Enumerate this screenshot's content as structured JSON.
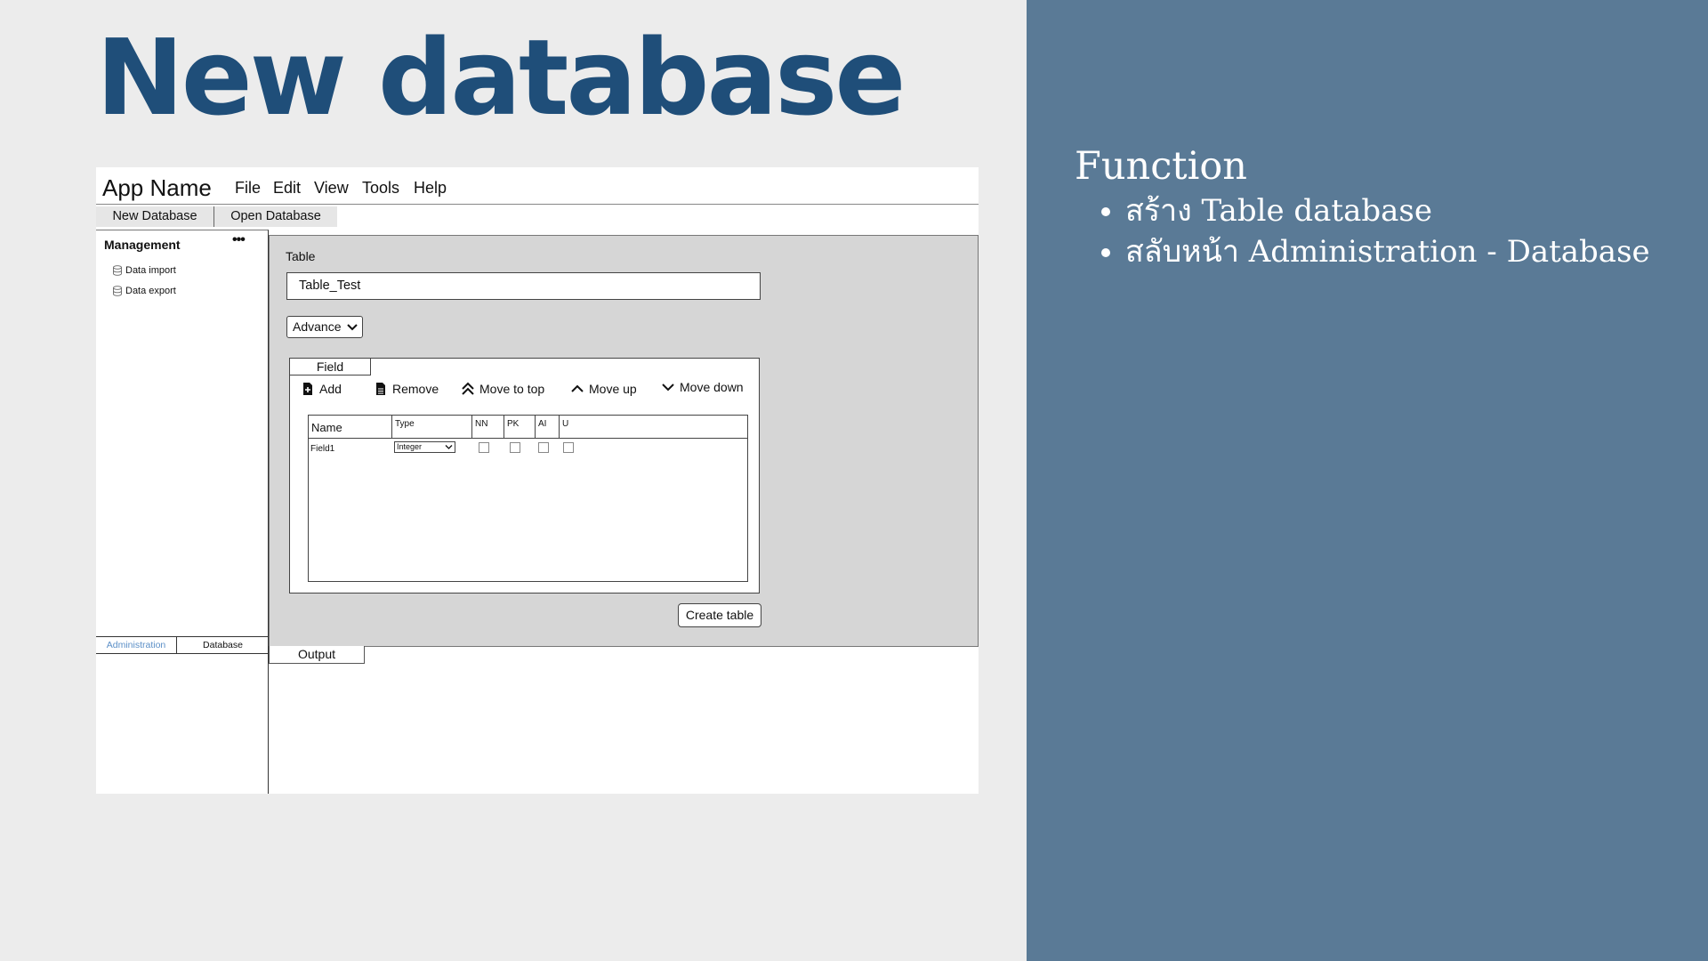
{
  "slide": {
    "title": "New database"
  },
  "function_panel": {
    "heading": "Function",
    "items": [
      "สร้าง Table database",
      "สลับหน้า Administration - Database"
    ]
  },
  "app": {
    "name": "App Name",
    "menu": [
      "File",
      "Edit",
      "View",
      "Tools",
      "Help"
    ],
    "toolbar_tabs": [
      "New Database",
      "Open Database"
    ]
  },
  "sidebar": {
    "title": "Management",
    "more": "•••",
    "items": [
      {
        "label": "Data import",
        "icon": "database-icon"
      },
      {
        "label": "Data export",
        "icon": "database-icon"
      }
    ],
    "tabs": [
      {
        "label": "Administration",
        "active": true
      },
      {
        "label": "Database",
        "active": false
      }
    ]
  },
  "editor": {
    "table_label": "Table",
    "table_name": "Table_Test",
    "advance_label": "Advance",
    "field_tab": "Field",
    "tools": [
      {
        "label": "Add",
        "icon": "add-file-icon"
      },
      {
        "label": "Remove",
        "icon": "remove-file-icon"
      },
      {
        "label": "Move to top",
        "icon": "double-chevron-up-icon"
      },
      {
        "label": "Move up",
        "icon": "chevron-up-icon"
      },
      {
        "label": "Move down",
        "icon": "chevron-down-icon"
      }
    ],
    "columns": [
      "Name",
      "Type",
      "NN",
      "PK",
      "AI",
      "U"
    ],
    "rows": [
      {
        "name": "Field1",
        "type": "Integer",
        "nn": false,
        "pk": false,
        "ai": false,
        "u": false
      }
    ],
    "create_label": "Create table"
  },
  "output": {
    "tab_label": "Output"
  },
  "colors": {
    "title": "#1f4e79",
    "panel": "#5a7a96",
    "active_tab_text": "#5b8fc7"
  }
}
